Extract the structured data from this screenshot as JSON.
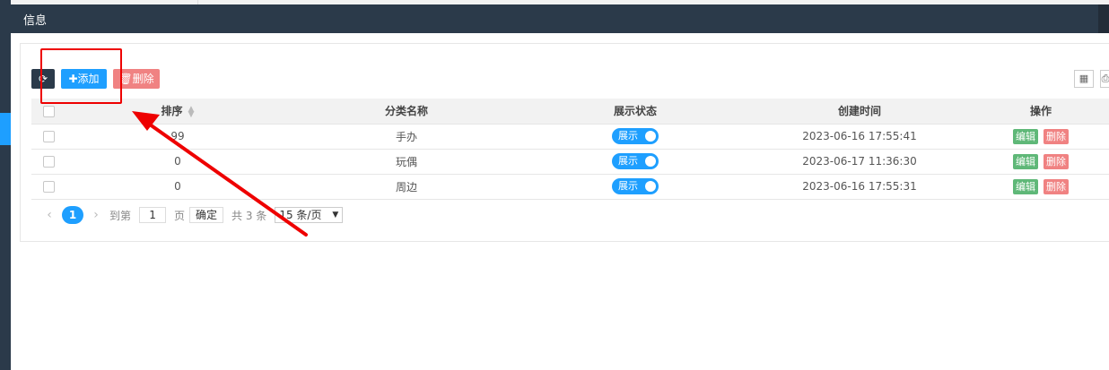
{
  "header": {
    "title": "信息"
  },
  "toolbar": {
    "add_label": "添加",
    "delete_label": "删除"
  },
  "table": {
    "columns": [
      "排序",
      "分类名称",
      "展示状态",
      "创建时间",
      "操作"
    ],
    "rows": [
      {
        "sort": "99",
        "name": "手办",
        "status": "展示",
        "created": "2023-06-16 17:55:41",
        "edit": "编辑",
        "delete": "删除"
      },
      {
        "sort": "0",
        "name": "玩偶",
        "status": "展示",
        "created": "2023-06-17 11:36:30",
        "edit": "编辑",
        "delete": "删除"
      },
      {
        "sort": "0",
        "name": "周边",
        "status": "展示",
        "created": "2023-06-16 17:55:31",
        "edit": "编辑",
        "delete": "删除"
      }
    ]
  },
  "pagination": {
    "current_page": "1",
    "goto_label": "到第",
    "page_input": "1",
    "page_unit": "页",
    "confirm_label": "确定",
    "total_label": "共 3 条",
    "page_size": "15 条/页"
  },
  "colors": {
    "primary": "#1e9fff",
    "danger": "#f08282",
    "success": "#5fb878",
    "header_bg": "#2b3a4a"
  }
}
